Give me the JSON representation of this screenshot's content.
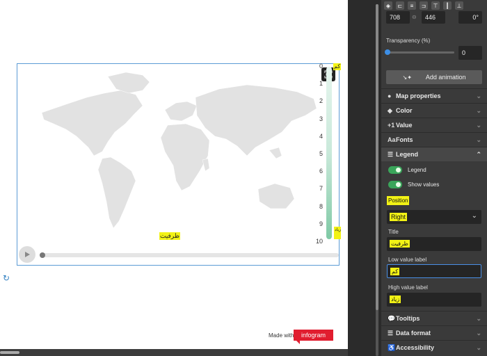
{
  "canvas": {
    "map_title": "ظرفیت",
    "legend_low": "کم",
    "legend_high": "زیاد",
    "legend_ticks": [
      "0",
      "1",
      "2",
      "3",
      "4",
      "5",
      "6",
      "7",
      "8",
      "9",
      "10"
    ],
    "made_with": "Made with",
    "brand": "infogram"
  },
  "panel": {
    "toolbar_icons": [
      "layers-icon",
      "align-left-icon",
      "align-center-icon",
      "align-right-icon",
      "align-top-icon",
      "align-middle-icon",
      "align-bottom-icon"
    ],
    "width_value": "708",
    "height_value": "446",
    "rotation_value": "0°",
    "transparency_label": "Transparency (%)",
    "transparency_value": "0",
    "add_animation": "Add animation",
    "sections_top": [
      {
        "label": "Map properties",
        "icon": "globe-icon"
      },
      {
        "label": "Color",
        "icon": "paint-icon"
      },
      {
        "label": "Value",
        "icon": "plus-one-icon"
      },
      {
        "label": "Fonts",
        "icon": "font-icon"
      }
    ],
    "legend_section": "Legend",
    "legend_toggle": "Legend",
    "show_values_toggle": "Show values",
    "position_label": "Position",
    "position_value": "Right",
    "title_label": "Title",
    "title_value": "ظرفیت",
    "low_label": "Low value label",
    "low_value": "کم",
    "high_label": "High value label",
    "high_value": "زیاد",
    "sections_bottom": [
      {
        "label": "Tooltips",
        "icon": "speech-bubble-icon"
      },
      {
        "label": "Data format",
        "icon": "list-icon"
      },
      {
        "label": "Accessibility",
        "icon": "accessibility-icon"
      }
    ],
    "accent_green": "#3aa55a",
    "accent_blue": "#4a8fe6",
    "highlight_yellow": "#f2f215"
  }
}
